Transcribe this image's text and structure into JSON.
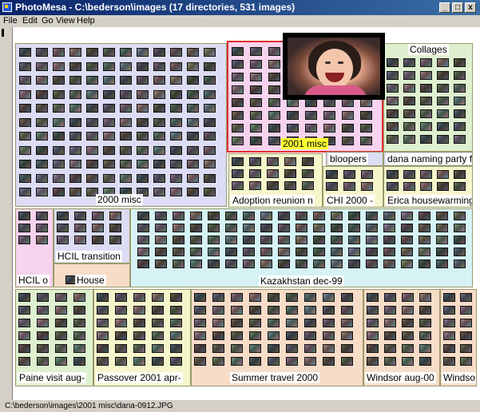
{
  "window": {
    "title": "PhotoMesa - C:\\bederson\\images (17 directories, 531 images)",
    "buttons": {
      "minimize": "_",
      "maximize": "□",
      "close": "x"
    }
  },
  "menu": [
    "File",
    "Edit",
    "Go",
    "View",
    "Help"
  ],
  "status": "C:\\bederson\\images\\2001 misc\\dana-0912.JPG",
  "preview": {
    "icon": "photo-preview",
    "subject": "laughing girl"
  },
  "colors": {
    "title_start": "#0a246a",
    "title_end": "#3a6ea5",
    "group_lavender": "#dcdcf4",
    "group_green": "#def0cf",
    "group_pink": "#f7d3ee",
    "group_peach": "#f7dcc8",
    "group_yellow": "#f6f6cc",
    "group_cyan": "#d6f2f4",
    "selected_border": "#e03030",
    "selected_label": "#ffff33"
  },
  "groups": [
    {
      "name": "2000 misc",
      "label": "2000 misc",
      "color": "#dcdcf4"
    },
    {
      "name": "2001 misc",
      "label": "2001 misc",
      "color": "#f7d3ee",
      "selected": true
    },
    {
      "name": "Collages",
      "label": "Collages",
      "color": "#def0cf"
    },
    {
      "name": "bloopers",
      "label": "bloopers",
      "color": "#dcdcf4"
    },
    {
      "name": "dana naming party",
      "label": "dana naming party f",
      "color": "#dcdcf4"
    },
    {
      "name": "Adoption reunion",
      "label": "Adoption reunion n",
      "color": "#f6f6cc"
    },
    {
      "name": "CHI 2000",
      "label": "CHI 2000 -",
      "color": "#f6f6cc"
    },
    {
      "name": "Erica housewarming",
      "label": "Erica housewarming",
      "color": "#f6f6cc"
    },
    {
      "name": "HCIL o",
      "label": "HCIL o",
      "color": "#f7d3ee"
    },
    {
      "name": "HCIL transition",
      "label": "HCIL transition",
      "color": "#dcdcf4"
    },
    {
      "name": "House",
      "label": "House",
      "color": "#f7dcc8"
    },
    {
      "name": "Kazakhstan dec-99",
      "label": "Kazakhstan dec-99",
      "color": "#d6f2f4"
    },
    {
      "name": "Paine visit aug",
      "label": "Paine visit aug-",
      "color": "#def0cf"
    },
    {
      "name": "Passover 2001 apr",
      "label": "Passover 2001 apr-",
      "color": "#f6f6cc"
    },
    {
      "name": "Summer travel 2000",
      "label": "Summer travel 2000",
      "color": "#f7dcc8"
    },
    {
      "name": "Windsor aug-00",
      "label": "Windsor aug-00",
      "color": "#f7dcc8"
    },
    {
      "name": "Windso",
      "label": "Windso",
      "color": "#f7dcc8"
    }
  ]
}
